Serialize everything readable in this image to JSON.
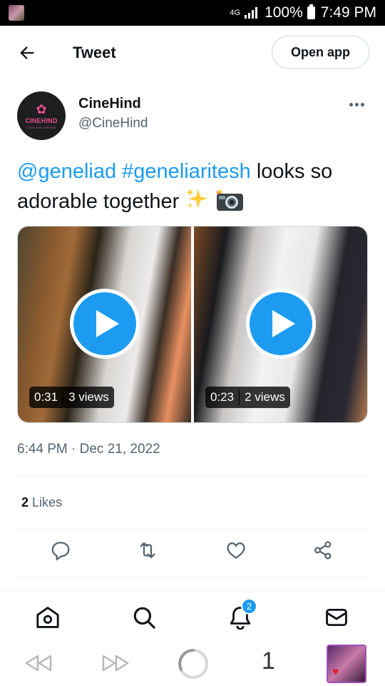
{
  "status_bar": {
    "network": "4G",
    "battery": "100%",
    "time": "7:49 PM"
  },
  "header": {
    "title": "Tweet",
    "open_app_label": "Open app"
  },
  "tweet": {
    "author_name": "CineHind",
    "author_handle": "@CineHind",
    "avatar_brand": "CINEHIND",
    "avatar_tagline": "LOVE BOLLYWOOD",
    "text_mention": "@geneliad",
    "text_hashtag": "#geneliaritesh",
    "text_body": "looks so adorable together",
    "emojis": [
      "sparkles",
      "camera-with-flash"
    ],
    "videos": [
      {
        "duration": "0:31",
        "views": "3 views"
      },
      {
        "duration": "0:23",
        "views": "2 views"
      }
    ],
    "timestamp": "6:44 PM · Dec 21, 2022",
    "likes_count": "2",
    "likes_label": "Likes"
  },
  "actions": [
    "reply-icon",
    "retweet-icon",
    "like-icon",
    "share-icon"
  ],
  "bottom_nav": {
    "items": [
      "home-icon",
      "search-icon",
      "notifications-icon",
      "messages-icon"
    ],
    "notifications_badge": "2"
  },
  "browser_bar": {
    "tab_count": "1"
  },
  "colors": {
    "accent": "#1d9bf0",
    "text": "#0f1419",
    "secondary": "#536471",
    "border": "#cfd9de"
  }
}
